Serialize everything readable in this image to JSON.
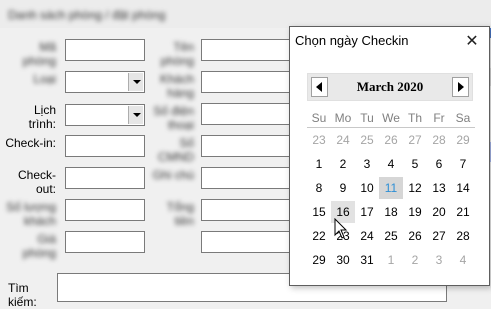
{
  "window": {
    "title": "Danh sách phòng / đặt phòng"
  },
  "form": {
    "room_label": "Mã phòng",
    "type_label": "Loại",
    "schedule_label": "Lịch\ntrình:",
    "checkin_label": "Check-in:",
    "checkout_label": "Check-out:",
    "guests_label": "Số lượng khách",
    "price_label": "Giá phòng",
    "room_name_label": "Tên phòng",
    "guest_name_label": "Khách hàng",
    "phone_label": "Số điện thoại",
    "id_label": "Số CMND",
    "note_label": "Ghi chú",
    "total_label": "Tổng tiền",
    "search_label": "Tìm kiếm:",
    "search_value": ""
  },
  "calendar": {
    "title": "Chọn ngày Checkin",
    "close_glyph": "✕",
    "close_icon": "close-icon",
    "prev_icon": "chevron-left-icon",
    "next_icon": "chevron-right-icon",
    "month_label": "March  2020",
    "dow": [
      "Su",
      "Mo",
      "Tu",
      "We",
      "Th",
      "Fr",
      "Sa"
    ],
    "today": "11",
    "hovered": "16",
    "weeks": [
      [
        {
          "d": "23",
          "o": true
        },
        {
          "d": "24",
          "o": true
        },
        {
          "d": "25",
          "o": true
        },
        {
          "d": "26",
          "o": true
        },
        {
          "d": "27",
          "o": true
        },
        {
          "d": "28",
          "o": true
        },
        {
          "d": "29",
          "o": true
        }
      ],
      [
        {
          "d": "1"
        },
        {
          "d": "2"
        },
        {
          "d": "3"
        },
        {
          "d": "4"
        },
        {
          "d": "5"
        },
        {
          "d": "6"
        },
        {
          "d": "7"
        }
      ],
      [
        {
          "d": "8"
        },
        {
          "d": "9"
        },
        {
          "d": "10"
        },
        {
          "d": "11"
        },
        {
          "d": "12"
        },
        {
          "d": "13"
        },
        {
          "d": "14"
        }
      ],
      [
        {
          "d": "15"
        },
        {
          "d": "16"
        },
        {
          "d": "17"
        },
        {
          "d": "18"
        },
        {
          "d": "19"
        },
        {
          "d": "20"
        },
        {
          "d": "21"
        }
      ],
      [
        {
          "d": "22"
        },
        {
          "d": "23"
        },
        {
          "d": "24"
        },
        {
          "d": "25"
        },
        {
          "d": "26"
        },
        {
          "d": "27"
        },
        {
          "d": "28"
        }
      ],
      [
        {
          "d": "29"
        },
        {
          "d": "30"
        },
        {
          "d": "31"
        },
        {
          "d": "1",
          "o": true
        },
        {
          "d": "2",
          "o": true
        },
        {
          "d": "3",
          "o": true
        },
        {
          "d": "4",
          "o": true
        }
      ]
    ]
  },
  "colors": {
    "today_text": "#2d8fd5",
    "edge_blue": "#4a78c9",
    "edge_accent": "#a9b9ee"
  }
}
